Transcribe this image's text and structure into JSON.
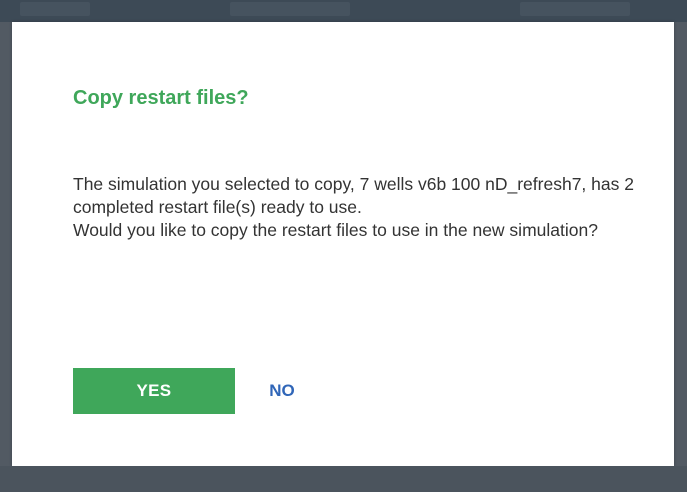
{
  "dialog": {
    "title": "Copy restart files?",
    "message_line_1": "The simulation you selected to copy, 7 wells v6b 100 nD_refresh7, has 2 completed restart file(s) ready to use.",
    "message_line_2": "Would you like to copy the restart files to use in the new simulation?",
    "yes_label": "YES",
    "no_label": "NO"
  },
  "colors": {
    "title": "#3fa75a",
    "primary_button": "#3fa75a",
    "secondary_link": "#3066b8",
    "overlay": "#525a63"
  }
}
